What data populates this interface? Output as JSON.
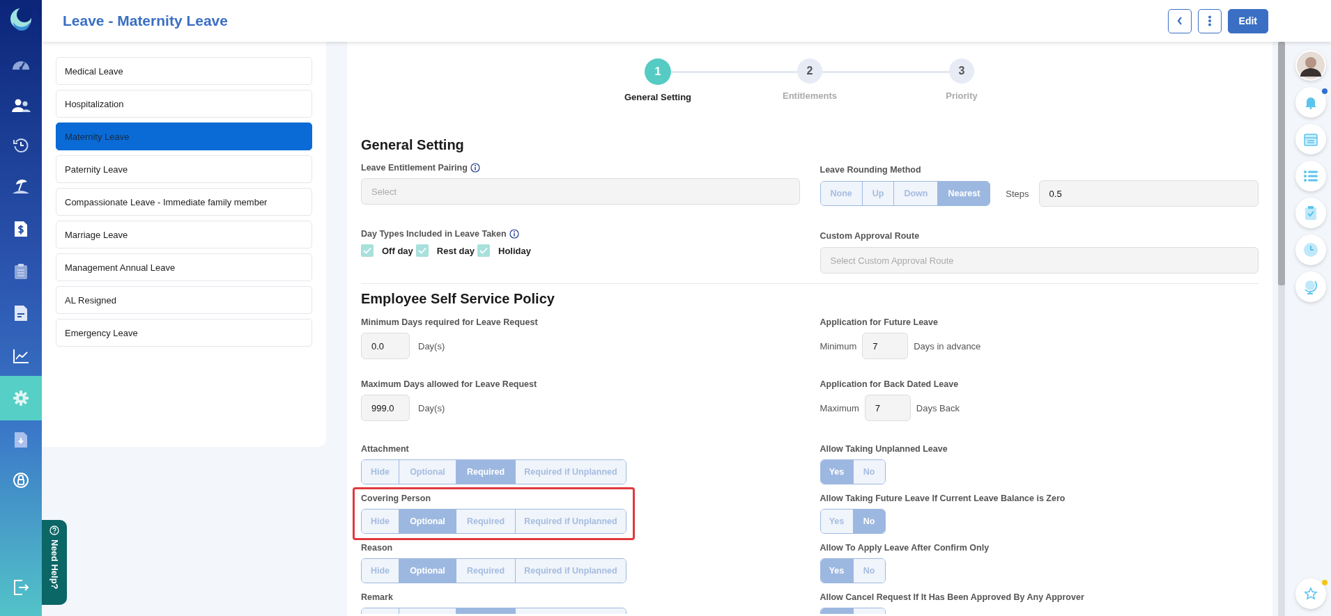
{
  "nav": [
    {
      "selected": false
    },
    {
      "selected": false
    },
    {
      "selected": false
    },
    {
      "selected": false
    },
    {
      "selected": false
    },
    {
      "selected": false
    },
    {
      "selected": false
    },
    {
      "selected": false
    },
    {
      "selected": true
    },
    {
      "selected": false
    },
    {
      "selected": false
    }
  ],
  "header": {
    "title": "Leave - Maternity Leave",
    "edit_button": "Edit"
  },
  "leave_types": [
    {
      "label": "Medical Leave",
      "selected": false
    },
    {
      "label": "Hospitalization",
      "selected": false
    },
    {
      "label": "Maternity Leave",
      "selected": true
    },
    {
      "label": "Paternity Leave",
      "selected": false
    },
    {
      "label": "Compassionate Leave - Immediate family member",
      "selected": false
    },
    {
      "label": "Marriage Leave",
      "selected": false
    },
    {
      "label": "Management Annual Leave",
      "selected": false
    },
    {
      "label": "AL Resigned",
      "selected": false
    },
    {
      "label": "Emergency Leave",
      "selected": false
    }
  ],
  "stepper": [
    {
      "number": "1",
      "label": "General Setting",
      "selected": true
    },
    {
      "number": "2",
      "label": "Entitlements",
      "selected": false
    },
    {
      "number": "3",
      "label": "Priority",
      "selected": false
    }
  ],
  "general_setting": {
    "heading": "General Setting",
    "pairing": {
      "label": "Leave Entitlement Pairing",
      "placeholder": "Select"
    },
    "rounding": {
      "label": "Leave Rounding Method",
      "options": [
        {
          "label": "None",
          "selected": false
        },
        {
          "label": "Up",
          "selected": false
        },
        {
          "label": "Down",
          "selected": false
        },
        {
          "label": "Nearest",
          "selected": true
        }
      ],
      "steps_label": "Steps",
      "steps_value": "0.5"
    },
    "day_types": {
      "label": "Day Types Included in Leave Taken",
      "options": [
        {
          "label": "Off day",
          "checked": true
        },
        {
          "label": "Rest day",
          "checked": true
        },
        {
          "label": "Holiday",
          "checked": true
        }
      ]
    },
    "approval_route": {
      "label": "Custom Approval Route",
      "placeholder": "Select Custom Approval Route"
    }
  },
  "self_service": {
    "heading": "Employee Self Service Policy",
    "min_days": {
      "label": "Minimum Days required for Leave Request",
      "value": "0.0",
      "unit": "Day(s)"
    },
    "future": {
      "label": "Application for Future Leave",
      "prefix": "Minimum",
      "value": "7",
      "suffix": "Days in advance"
    },
    "max_days": {
      "label": "Maximum Days allowed for Leave Request",
      "value": "999.0",
      "unit": "Day(s)"
    },
    "back": {
      "label": "Application for Back Dated Leave",
      "prefix": "Maximum",
      "value": "7",
      "suffix": "Days Back"
    },
    "requirements": [
      {
        "label": "Attachment",
        "highlighted": false,
        "options": [
          {
            "label": "Hide",
            "selected": false
          },
          {
            "label": "Optional",
            "selected": false
          },
          {
            "label": "Required",
            "selected": true
          },
          {
            "label": "Required if Unplanned",
            "selected": false
          }
        ]
      },
      {
        "label": "Covering Person",
        "highlighted": true,
        "options": [
          {
            "label": "Hide",
            "selected": false
          },
          {
            "label": "Optional",
            "selected": true
          },
          {
            "label": "Required",
            "selected": false
          },
          {
            "label": "Required if Unplanned",
            "selected": false
          }
        ]
      },
      {
        "label": "Reason",
        "highlighted": false,
        "options": [
          {
            "label": "Hide",
            "selected": false
          },
          {
            "label": "Optional",
            "selected": true
          },
          {
            "label": "Required",
            "selected": false
          },
          {
            "label": "Required if Unplanned",
            "selected": false
          }
        ]
      },
      {
        "label": "Remark",
        "highlighted": false,
        "options": [
          {
            "selected": false
          },
          {
            "selected": false
          },
          {
            "selected": true
          },
          {
            "selected": false
          }
        ]
      }
    ],
    "permissions": [
      {
        "label": "Allow Taking Unplanned Leave",
        "options": [
          {
            "label": "Yes",
            "selected": true
          },
          {
            "label": "No",
            "selected": false
          }
        ]
      },
      {
        "label": "Allow Taking Future Leave If Current Leave Balance is Zero",
        "options": [
          {
            "label": "Yes",
            "selected": false
          },
          {
            "label": "No",
            "selected": true
          }
        ]
      },
      {
        "label": "Allow To Apply Leave After Confirm Only",
        "options": [
          {
            "label": "Yes",
            "selected": true
          },
          {
            "label": "No",
            "selected": false
          }
        ]
      },
      {
        "label": "Allow Cancel Request If It Has Been Approved By Any Approver",
        "options": [
          {
            "selected": true
          },
          {
            "selected": false
          }
        ]
      }
    ]
  },
  "need_help": "Need Help?"
}
